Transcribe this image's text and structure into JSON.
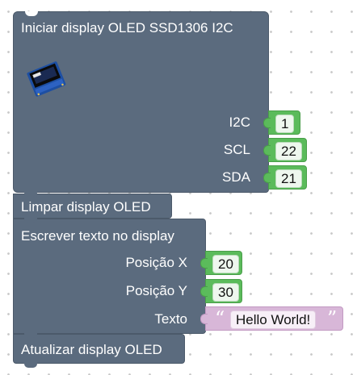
{
  "blocks": {
    "init": {
      "title": "Iniciar display OLED SSD1306 I2C",
      "image_label": "0.96\" OLED",
      "inputs": [
        {
          "label": "I2C",
          "value": "1"
        },
        {
          "label": "SCL",
          "value": "22"
        },
        {
          "label": "SDA",
          "value": "21"
        }
      ]
    },
    "clear": {
      "title": "Limpar display OLED"
    },
    "write": {
      "title": "Escrever texto no display",
      "inputs": [
        {
          "label": "Posição X",
          "value": "20"
        },
        {
          "label": "Posição Y",
          "value": "30"
        },
        {
          "label": "Texto",
          "value": "Hello World!"
        }
      ]
    },
    "update": {
      "title": "Atualizar display OLED"
    }
  },
  "colors": {
    "statement_block": "#5b6b7e",
    "number_block": "#5bbb5b",
    "text_block": "#d8b7d8",
    "workspace": "#ffffff"
  }
}
